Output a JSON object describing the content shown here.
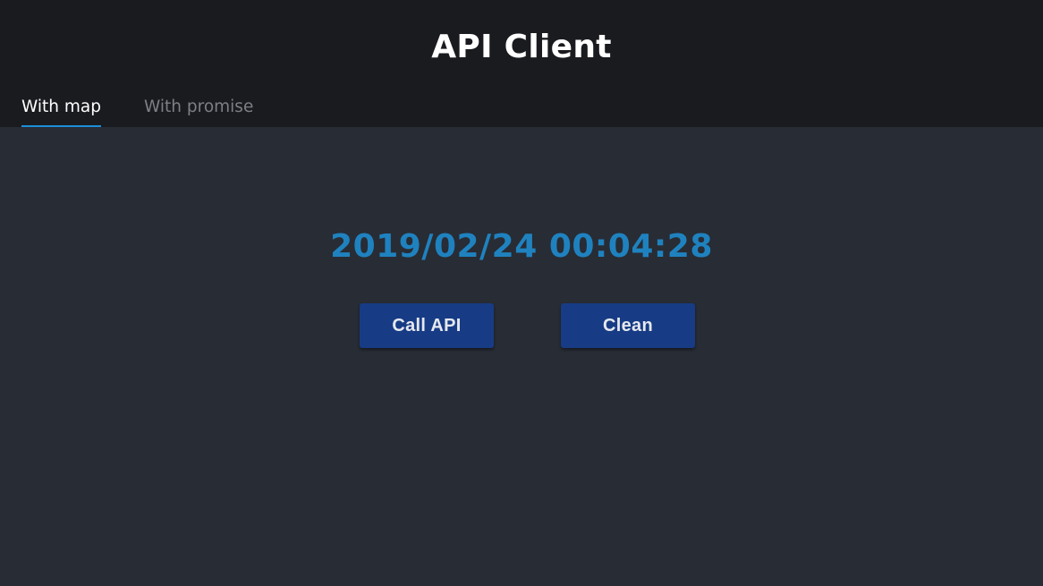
{
  "header": {
    "title": "API Client"
  },
  "tabs": [
    {
      "label": "With map",
      "active": true
    },
    {
      "label": "With promise",
      "active": false
    }
  ],
  "main": {
    "timestamp": "2019/02/24 00:04:28",
    "call_button_label": "Call API",
    "clean_button_label": "Clean"
  },
  "colors": {
    "header_bg": "#1a1b1f",
    "main_bg": "#282c35",
    "accent": "#1b8fd8",
    "timestamp": "#1f82bf",
    "button_bg": "#173c85"
  }
}
